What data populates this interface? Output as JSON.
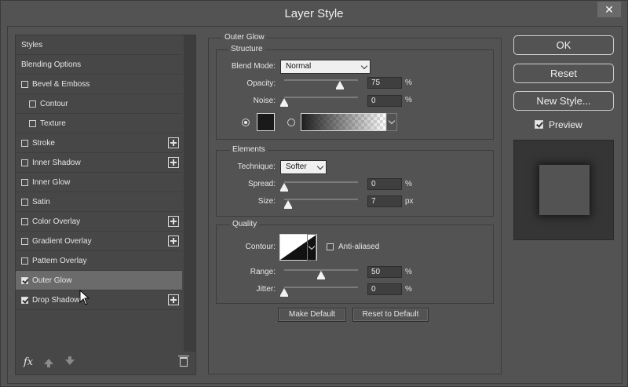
{
  "window": {
    "title": "Layer Style",
    "close_glyph": "✕"
  },
  "styles_list": {
    "items": [
      {
        "label": "Styles",
        "checkbox": false,
        "checked": false,
        "add": false,
        "sub": false,
        "selected": false
      },
      {
        "label": "Blending Options",
        "checkbox": false,
        "checked": false,
        "add": false,
        "sub": false,
        "selected": false
      },
      {
        "label": "Bevel & Emboss",
        "checkbox": true,
        "checked": false,
        "add": false,
        "sub": false,
        "selected": false
      },
      {
        "label": "Contour",
        "checkbox": true,
        "checked": false,
        "add": false,
        "sub": true,
        "selected": false
      },
      {
        "label": "Texture",
        "checkbox": true,
        "checked": false,
        "add": false,
        "sub": true,
        "selected": false
      },
      {
        "label": "Stroke",
        "checkbox": true,
        "checked": false,
        "add": true,
        "sub": false,
        "selected": false
      },
      {
        "label": "Inner Shadow",
        "checkbox": true,
        "checked": false,
        "add": true,
        "sub": false,
        "selected": false
      },
      {
        "label": "Inner Glow",
        "checkbox": true,
        "checked": false,
        "add": false,
        "sub": false,
        "selected": false
      },
      {
        "label": "Satin",
        "checkbox": true,
        "checked": false,
        "add": false,
        "sub": false,
        "selected": false
      },
      {
        "label": "Color Overlay",
        "checkbox": true,
        "checked": false,
        "add": true,
        "sub": false,
        "selected": false
      },
      {
        "label": "Gradient Overlay",
        "checkbox": true,
        "checked": false,
        "add": true,
        "sub": false,
        "selected": false
      },
      {
        "label": "Pattern Overlay",
        "checkbox": true,
        "checked": false,
        "add": false,
        "sub": false,
        "selected": false
      },
      {
        "label": "Outer Glow",
        "checkbox": true,
        "checked": true,
        "add": false,
        "sub": false,
        "selected": true
      },
      {
        "label": "Drop Shadow",
        "checkbox": true,
        "checked": true,
        "add": true,
        "sub": false,
        "selected": false
      }
    ],
    "footer": {
      "fx_label": "fx"
    }
  },
  "outer_glow": {
    "title": "Outer Glow",
    "structure": {
      "title": "Structure",
      "blend_mode_label": "Blend Mode:",
      "blend_mode_value": "Normal",
      "opacity_label": "Opacity:",
      "opacity_value": "75",
      "opacity_unit": "%",
      "opacity_fraction": 0.75,
      "noise_label": "Noise:",
      "noise_value": "0",
      "noise_unit": "%",
      "noise_fraction": 0,
      "glow_color": "#1a1a1a"
    },
    "elements": {
      "title": "Elements",
      "technique_label": "Technique:",
      "technique_value": "Softer",
      "spread_label": "Spread:",
      "spread_value": "0",
      "spread_unit": "%",
      "spread_fraction": 0,
      "size_label": "Size:",
      "size_value": "7",
      "size_unit": "px",
      "size_fraction": 0.05
    },
    "quality": {
      "title": "Quality",
      "contour_label": "Contour:",
      "anti_aliased_label": "Anti-aliased",
      "range_label": "Range:",
      "range_value": "50",
      "range_unit": "%",
      "range_fraction": 0.5,
      "jitter_label": "Jitter:",
      "jitter_value": "0",
      "jitter_unit": "%",
      "jitter_fraction": 0
    },
    "make_default_label": "Make Default",
    "reset_default_label": "Reset to Default"
  },
  "actions": {
    "ok_label": "OK",
    "reset_label": "Reset",
    "new_style_label": "New Style...",
    "preview_label": "Preview"
  }
}
